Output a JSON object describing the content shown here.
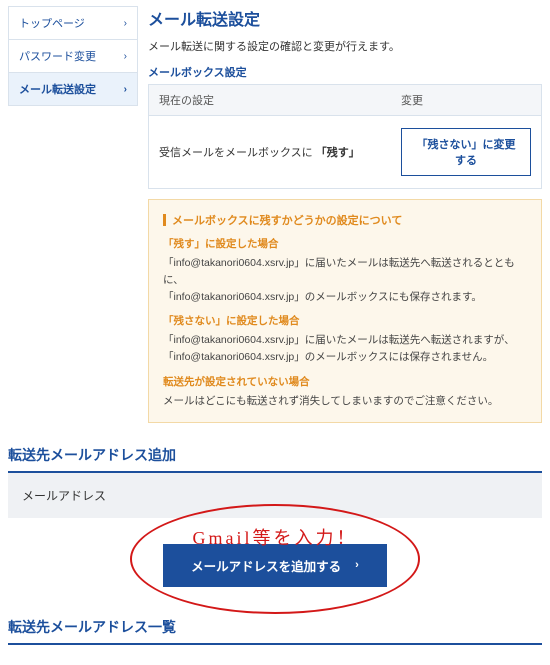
{
  "sidebar": {
    "items": [
      {
        "label": "トップページ"
      },
      {
        "label": "パスワード変更"
      },
      {
        "label": "メール転送設定"
      }
    ],
    "active_index": 2
  },
  "main": {
    "title": "メール転送設定",
    "lead": "メール転送に関する設定の確認と変更が行えます。",
    "mailbox": {
      "section_label": "メールボックス設定",
      "header_current": "現在の設定",
      "header_change": "変更",
      "current_prefix": "受信メールをメールボックスに",
      "current_value": "「残す」",
      "change_button": "「残さない」に変更する"
    },
    "info": {
      "title": "メールボックスに残すかどうかの設定について",
      "keep_sub": "「残す」に設定した場合",
      "keep_line1": "「info@takanori0604.xsrv.jp」に届いたメールは転送先へ転送されるとともに、",
      "keep_line2": "「info@takanori0604.xsrv.jp」のメールボックスにも保存されます。",
      "nokeep_sub": "「残さない」に設定した場合",
      "nokeep_line1": "「info@takanori0604.xsrv.jp」に届いたメールは転送先へ転送されますが、",
      "nokeep_line2": "「info@takanori0604.xsrv.jp」のメールボックスには保存されません。",
      "nofwd_sub": "転送先が設定されていない場合",
      "nofwd_line": "メールはどこにも転送されず消失してしまいますのでご注意ください。"
    }
  },
  "add_section": {
    "heading": "転送先メールアドレス追加",
    "input_label": "メールアドレス",
    "annotation_text": "Gmail等を入力！",
    "button_label": "メールアドレスを追加する"
  },
  "list_section": {
    "heading": "転送先メールアドレス一覧"
  }
}
